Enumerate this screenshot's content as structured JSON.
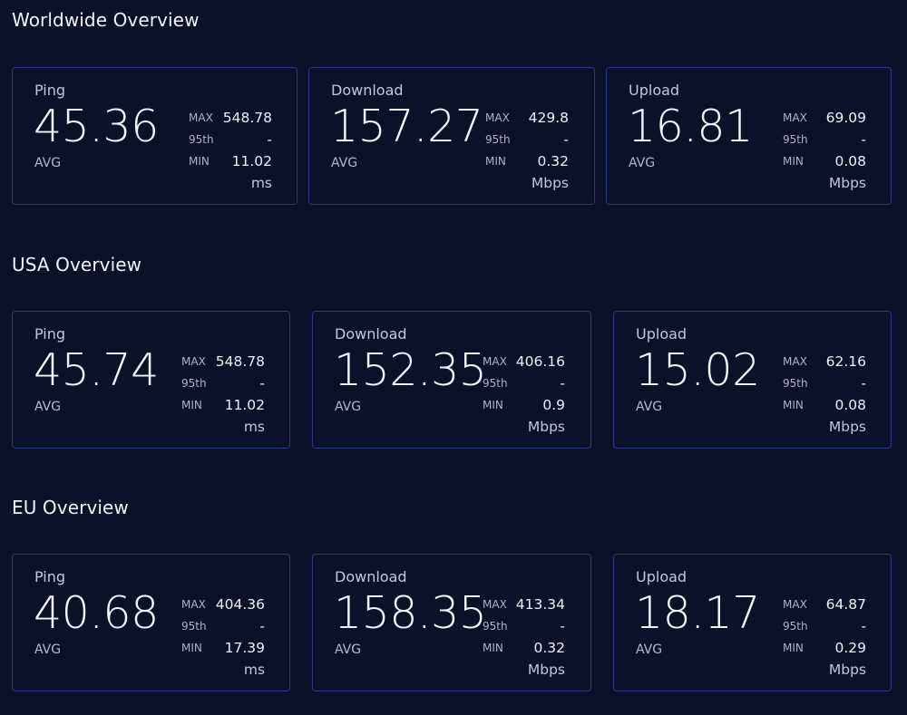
{
  "sections": [
    {
      "title": "Worldwide Overview",
      "cards": [
        {
          "label": "Ping",
          "avg": "45.36",
          "avg_label": "AVG",
          "max_label": "MAX",
          "max": "548.78",
          "p95_label": "95th",
          "p95": "-",
          "min_label": "MIN",
          "min": "11.02",
          "unit": "ms"
        },
        {
          "label": "Download",
          "avg": "157.27",
          "avg_label": "AVG",
          "max_label": "MAX",
          "max": "429.8",
          "p95_label": "95th",
          "p95": "-",
          "min_label": "MIN",
          "min": "0.32",
          "unit": "Mbps"
        },
        {
          "label": "Upload",
          "avg": "16.81",
          "avg_label": "AVG",
          "max_label": "MAX",
          "max": "69.09",
          "p95_label": "95th",
          "p95": "-",
          "min_label": "MIN",
          "min": "0.08",
          "unit": "Mbps"
        }
      ]
    },
    {
      "title": "USA Overview",
      "cards": [
        {
          "label": "Ping",
          "avg": "45.74",
          "avg_label": "AVG",
          "max_label": "MAX",
          "max": "548.78",
          "p95_label": "95th",
          "p95": "-",
          "min_label": "MIN",
          "min": "11.02",
          "unit": "ms"
        },
        {
          "label": "Download",
          "avg": "152.35",
          "avg_label": "AVG",
          "max_label": "MAX",
          "max": "406.16",
          "p95_label": "95th",
          "p95": "-",
          "min_label": "MIN",
          "min": "0.9",
          "unit": "Mbps"
        },
        {
          "label": "Upload",
          "avg": "15.02",
          "avg_label": "AVG",
          "max_label": "MAX",
          "max": "62.16",
          "p95_label": "95th",
          "p95": "-",
          "min_label": "MIN",
          "min": "0.08",
          "unit": "Mbps"
        }
      ]
    },
    {
      "title": "EU Overview",
      "cards": [
        {
          "label": "Ping",
          "avg": "40.68",
          "avg_label": "AVG",
          "max_label": "MAX",
          "max": "404.36",
          "p95_label": "95th",
          "p95": "-",
          "min_label": "MIN",
          "min": "17.39",
          "unit": "ms"
        },
        {
          "label": "Download",
          "avg": "158.35",
          "avg_label": "AVG",
          "max_label": "MAX",
          "max": "413.34",
          "p95_label": "95th",
          "p95": "-",
          "min_label": "MIN",
          "min": "0.32",
          "unit": "Mbps"
        },
        {
          "label": "Upload",
          "avg": "18.17",
          "avg_label": "AVG",
          "max_label": "MAX",
          "max": "64.87",
          "p95_label": "95th",
          "p95": "-",
          "min_label": "MIN",
          "min": "0.29",
          "unit": "Mbps"
        }
      ]
    }
  ],
  "colors": {
    "background": "#0b1129",
    "card_border": "#2a3a80"
  }
}
